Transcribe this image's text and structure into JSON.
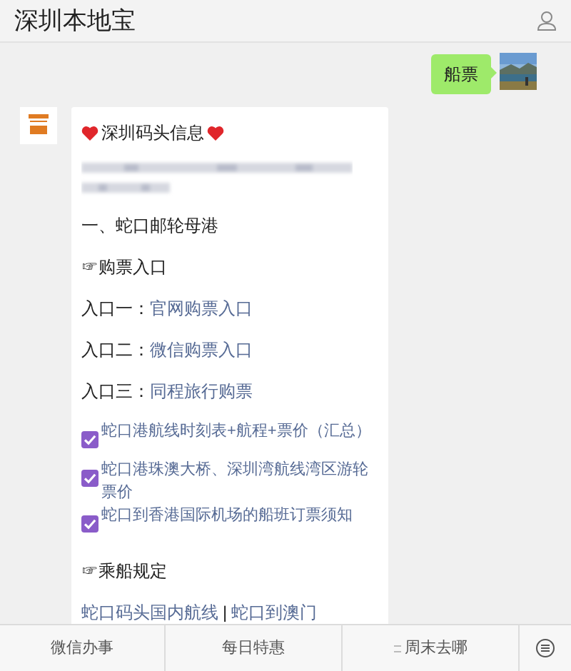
{
  "header": {
    "title": "深圳本地宝"
  },
  "sent_message": {
    "text": "船票"
  },
  "article": {
    "items": [
      {
        "kind": "title",
        "text": "深圳码头信息"
      },
      {
        "kind": "blurred"
      },
      {
        "kind": "text",
        "text": "一、蛇口邮轮母港"
      },
      {
        "kind": "pointer",
        "text": "☞购票入口"
      },
      {
        "kind": "entry",
        "label": "入口一：",
        "link": "官网购票入口"
      },
      {
        "kind": "entry",
        "label": "入口二：",
        "link": "微信购票入口"
      },
      {
        "kind": "entry",
        "label": "入口三：",
        "link": "同程旅行购票"
      },
      {
        "kind": "checklink",
        "text": "蛇口港航线时刻表+航程+票价（汇总）"
      },
      {
        "kind": "checklink",
        "text": "蛇口港珠澳大桥、深圳湾航线湾区游轮票价"
      },
      {
        "kind": "checklink",
        "text": "蛇口到香港国际机场的船班订票须知"
      },
      {
        "kind": "pointer",
        "text": "☞乘船规定"
      },
      {
        "kind": "links",
        "links": [
          "蛇口码头国内航线",
          "蛇口到澳门"
        ],
        "separator": "|"
      }
    ]
  },
  "tab_bar": {
    "tabs": [
      {
        "label": "微信办事",
        "icon": false
      },
      {
        "label": "每日特惠",
        "icon": false
      },
      {
        "label": "周末去哪",
        "icon": true
      }
    ]
  }
}
